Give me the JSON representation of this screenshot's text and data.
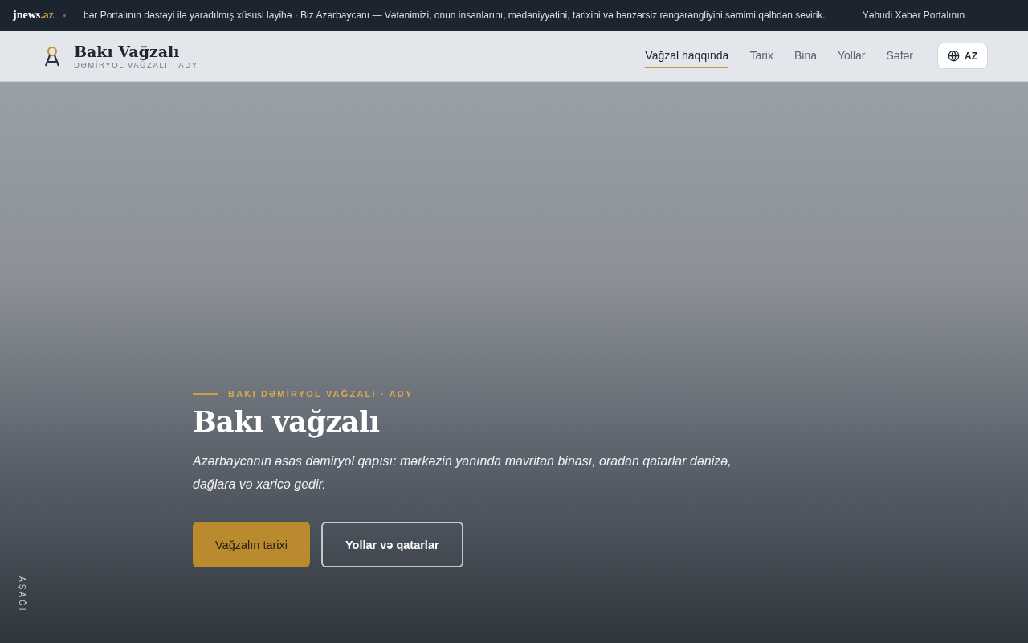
{
  "ticker": {
    "logo": "jnews",
    "logo_tld": ".az",
    "items": [
      "bər Portalının dəstəyi ilə yaradılmış xüsusi layihə · Biz Azərbaycanı — Vətənimizi, onun insanlarını, mədəniyyətini, tarixini və bənzərsiz rəngarəngliyini səmimi qəlbdən sevirik.",
      "Yəhudi Xəbər Portalının"
    ]
  },
  "header": {
    "title": "Bakı Vağzalı",
    "subtitle": "DƏMİRYOL VAĞZALI · ADY",
    "nav": [
      {
        "label": "Vağzal haqqında",
        "selected": true
      },
      {
        "label": "Tarix",
        "selected": false
      },
      {
        "label": "Bina",
        "selected": false
      },
      {
        "label": "Yollar",
        "selected": false
      },
      {
        "label": "Səfər",
        "selected": false
      }
    ],
    "language": "AZ"
  },
  "hero": {
    "eyebrow": "BAKI DƏMİRYOL VAĞZALI · ADY",
    "title": "Bakı vağzalı",
    "lead": "Azərbaycanın əsas dəmiryol qapısı: mərkəzin yanında mavritan binası, oradan qatarlar dənizə, dağlara və xaricə gedir.",
    "buttons": [
      {
        "label": "Vağzalın tarixi",
        "kind": "primary"
      },
      {
        "label": "Yollar və qatarlar",
        "kind": "outline"
      }
    ],
    "scroll_hint": "AŞAĞI"
  }
}
